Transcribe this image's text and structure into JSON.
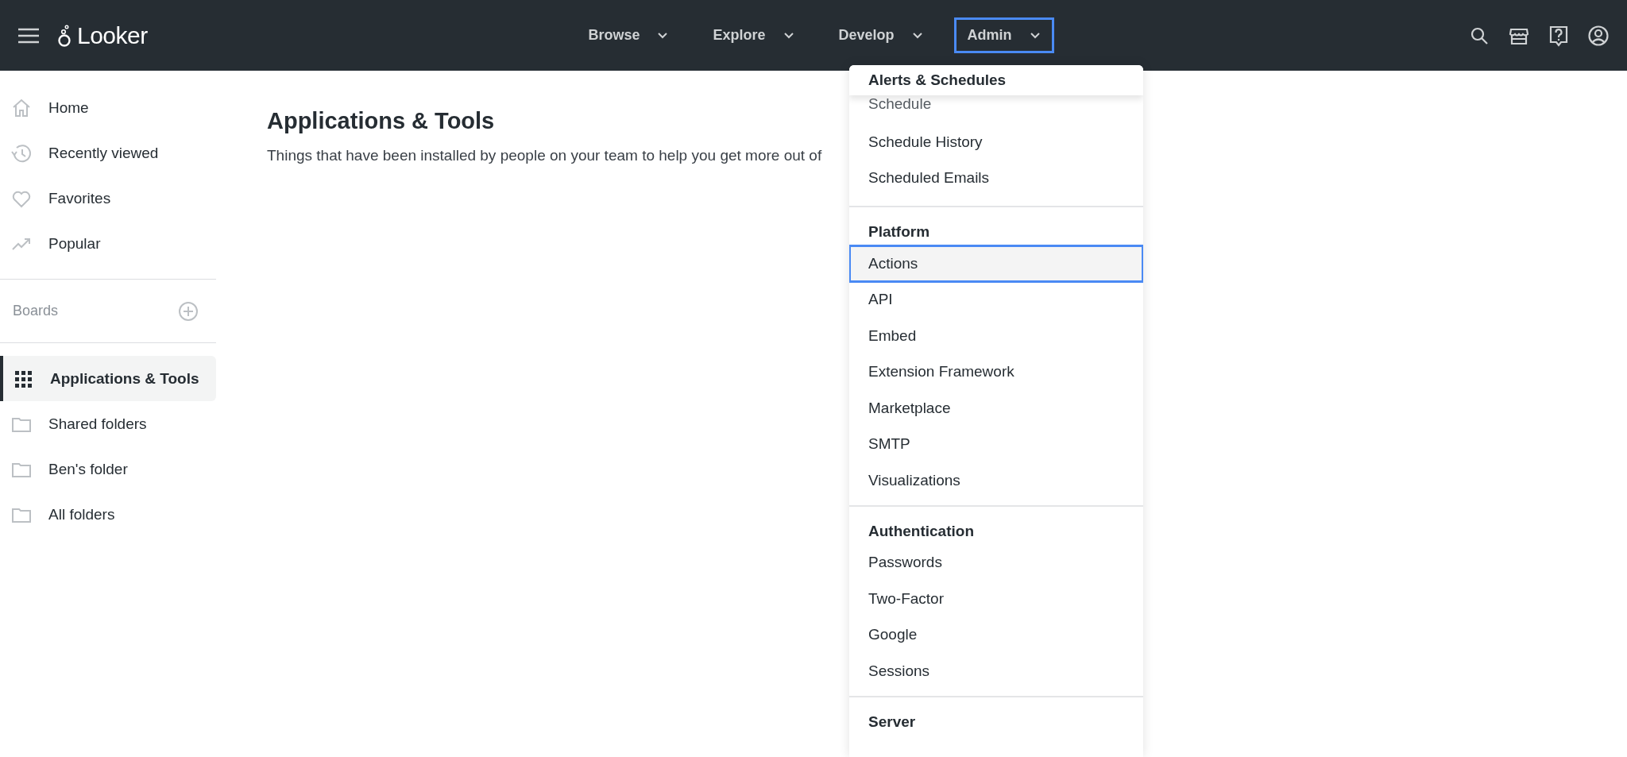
{
  "topbar": {
    "logo": "Looker",
    "nav": [
      {
        "label": "Browse",
        "selected": false
      },
      {
        "label": "Explore",
        "selected": false
      },
      {
        "label": "Develop",
        "selected": false
      },
      {
        "label": "Admin",
        "selected": true
      }
    ]
  },
  "sidebar": {
    "items": [
      {
        "label": "Home",
        "kind": "home",
        "selected": false
      },
      {
        "label": "Recently viewed",
        "kind": "history",
        "selected": false
      },
      {
        "label": "Favorites",
        "kind": "heart",
        "selected": false
      },
      {
        "label": "Popular",
        "kind": "trending",
        "selected": false
      }
    ],
    "boards_label": "Boards",
    "folders": [
      {
        "label": "Applications & Tools",
        "kind": "grid",
        "selected": true
      },
      {
        "label": "Shared folders",
        "kind": "folder",
        "selected": false
      },
      {
        "label": "Ben's folder",
        "kind": "folder",
        "selected": false
      },
      {
        "label": "All folders",
        "kind": "folder",
        "selected": false
      }
    ]
  },
  "main": {
    "title": "Applications & Tools",
    "description": "Things that have been installed by people on your team to help you get more out of"
  },
  "admin_menu": {
    "sections": [
      {
        "heading": "Alerts & Schedules",
        "items": [
          {
            "label": "Schedule",
            "selected": false
          },
          {
            "label": "Schedule History",
            "selected": false
          },
          {
            "label": "Scheduled Emails",
            "selected": false
          }
        ]
      },
      {
        "heading": "Platform",
        "items": [
          {
            "label": "Actions",
            "selected": true
          },
          {
            "label": "API",
            "selected": false
          },
          {
            "label": "Embed",
            "selected": false
          },
          {
            "label": "Extension Framework",
            "selected": false
          },
          {
            "label": "Marketplace",
            "selected": false
          },
          {
            "label": "SMTP",
            "selected": false
          },
          {
            "label": "Visualizations",
            "selected": false
          }
        ]
      },
      {
        "heading": "Authentication",
        "items": [
          {
            "label": "Passwords",
            "selected": false
          },
          {
            "label": "Two-Factor",
            "selected": false
          },
          {
            "label": "Google",
            "selected": false
          },
          {
            "label": "Sessions",
            "selected": false
          }
        ]
      },
      {
        "heading": "Server"
      }
    ]
  }
}
